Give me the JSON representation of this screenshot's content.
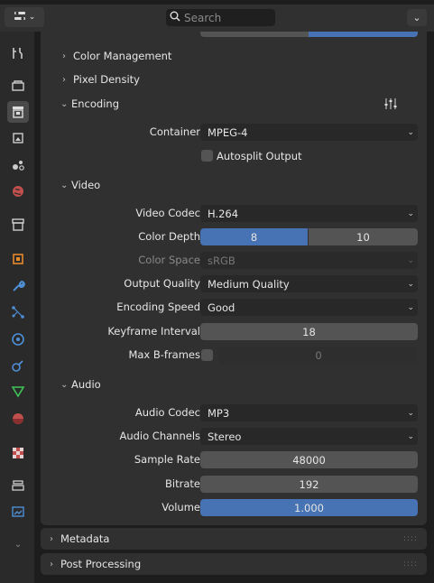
{
  "header": {
    "search_placeholder": "Search",
    "editor_type_icon": "properties-editor-icon",
    "menu_icon": "chevron-down-icon"
  },
  "sidebar": {
    "tabs": [
      {
        "icon": "tool-icon"
      },
      {
        "icon": "render-icon"
      },
      {
        "icon": "output-icon",
        "active": true
      },
      {
        "icon": "view-layer-icon"
      },
      {
        "icon": "scene-icon"
      },
      {
        "icon": "world-icon"
      },
      {
        "icon": "collection-icon"
      },
      {
        "icon": "object-icon"
      },
      {
        "icon": "modifier-icon"
      },
      {
        "icon": "particles-icon"
      },
      {
        "icon": "physics-icon"
      },
      {
        "icon": "constraints-icon"
      },
      {
        "icon": "data-icon"
      },
      {
        "icon": "material-icon"
      },
      {
        "icon": "texture-icon"
      },
      {
        "icon": "stack-icon"
      },
      {
        "icon": "image-icon"
      }
    ]
  },
  "sections": {
    "color_management": "Color Management",
    "pixel_density": "Pixel Density",
    "encoding": "Encoding",
    "video": "Video",
    "audio": "Audio",
    "metadata": "Metadata",
    "post_processing": "Post Processing"
  },
  "encoding": {
    "container_label": "Container",
    "container_value": "MPEG-4",
    "autosplit_label": "Autosplit Output",
    "autosplit_checked": false
  },
  "video": {
    "codec_label": "Video Codec",
    "codec_value": "H.264",
    "color_depth_label": "Color Depth",
    "color_depth_options": [
      "8",
      "10"
    ],
    "color_depth_selected": "8",
    "color_space_label": "Color Space",
    "color_space_value": "sRGB",
    "output_quality_label": "Output Quality",
    "output_quality_value": "Medium Quality",
    "encoding_speed_label": "Encoding Speed",
    "encoding_speed_value": "Good",
    "keyframe_label": "Keyframe Interval",
    "keyframe_value": "18",
    "bframes_label": "Max B-frames",
    "bframes_value": "0",
    "bframes_enabled": false
  },
  "audio": {
    "codec_label": "Audio Codec",
    "codec_value": "MP3",
    "channels_label": "Audio Channels",
    "channels_value": "Stereo",
    "sample_rate_label": "Sample Rate",
    "sample_rate_value": "48000",
    "bitrate_label": "Bitrate",
    "bitrate_value": "192",
    "volume_label": "Volume",
    "volume_value": "1.000"
  },
  "colors": {
    "accent": "#4772b3",
    "panel": "#303030",
    "field": "#282828"
  }
}
